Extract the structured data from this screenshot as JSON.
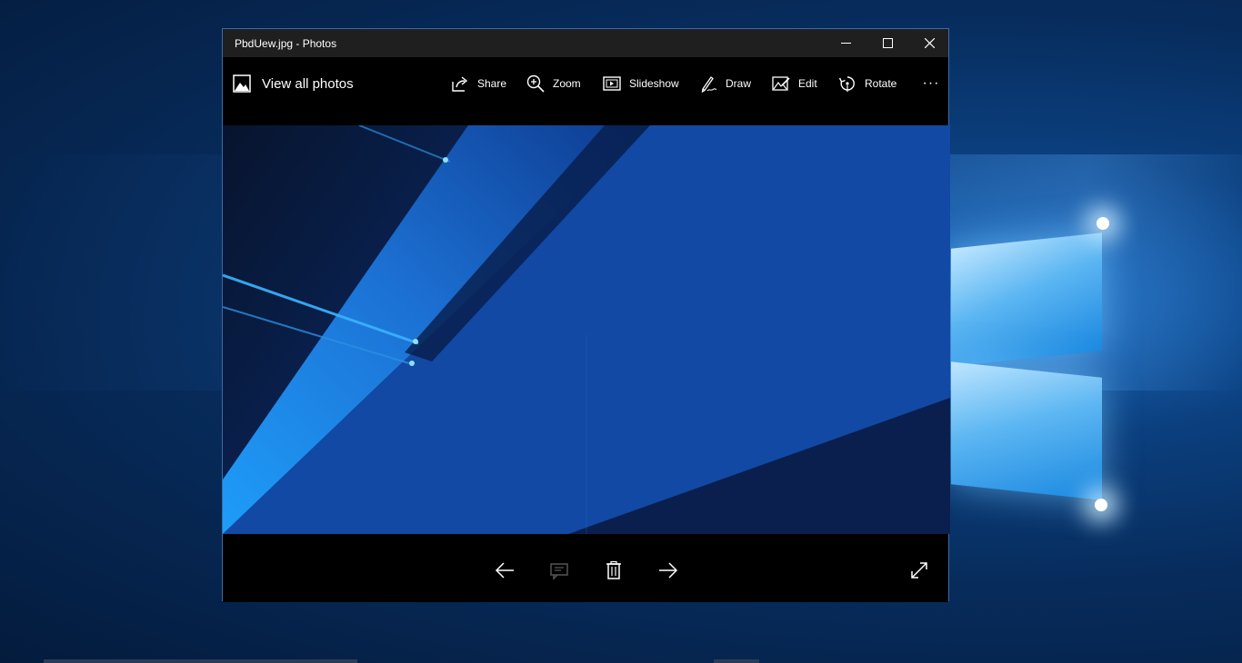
{
  "window": {
    "title": "PbdUew.jpg - Photos"
  },
  "toolbar": {
    "view_all_label": "View all photos",
    "share_label": "Share",
    "zoom_label": "Zoom",
    "slideshow_label": "Slideshow",
    "draw_label": "Draw",
    "edit_label": "Edit",
    "rotate_label": "Rotate",
    "more_label": "···"
  },
  "icons": {
    "minimize": "minimize-icon",
    "maximize": "maximize-icon",
    "close": "close-icon",
    "gallery": "image-gallery-icon",
    "share": "share-icon",
    "zoom": "zoom-icon",
    "slideshow": "slideshow-icon",
    "draw": "pen-icon",
    "edit": "edit-icon",
    "rotate": "rotate-icon",
    "previous": "arrow-left-icon",
    "feedback": "feedback-icon",
    "delete": "trash-icon",
    "next": "arrow-right-icon",
    "fullscreen": "fullscreen-icon"
  },
  "colors": {
    "titlebar": "#1f1f1f",
    "app_background": "#000000",
    "window_border": "#3c6aa8",
    "disabled_icon": "#5a5a5a"
  }
}
